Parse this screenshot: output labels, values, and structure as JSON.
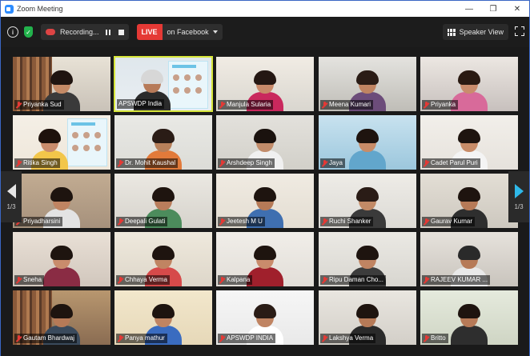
{
  "window": {
    "title": "Zoom Meeting"
  },
  "toolbar": {
    "recording_label": "Recording...",
    "live_label": "LIVE",
    "live_target": "on Facebook",
    "speaker_view_label": "Speaker View"
  },
  "pager": {
    "left": "1/3",
    "right": "1/3"
  },
  "participants": [
    {
      "name": "Priyanka Sud"
    },
    {
      "name": "APSWDP India"
    },
    {
      "name": "Manjula Sularia"
    },
    {
      "name": "Meena Kumari"
    },
    {
      "name": "Priyanka"
    },
    {
      "name": "Ritika Singh"
    },
    {
      "name": "Dr. Mohit Kaushal"
    },
    {
      "name": "Arshdeep Singh"
    },
    {
      "name": "Jaya"
    },
    {
      "name": "Cadet Parul Puri"
    },
    {
      "name": "Priyadharsini"
    },
    {
      "name": "Deepali Gulati"
    },
    {
      "name": "Jeetesh M U"
    },
    {
      "name": "Ruchi Shanker"
    },
    {
      "name": "Gaurav Kumar"
    },
    {
      "name": "Sneha"
    },
    {
      "name": "Chhaya Verma"
    },
    {
      "name": "Kalpana"
    },
    {
      "name": "Ripu Daman Cho..."
    },
    {
      "name": "RAJEEV KUMAR ..."
    },
    {
      "name": "Gautam Bhardwaj"
    },
    {
      "name": "Panya mathur"
    },
    {
      "name": "APSWDP INDIA"
    },
    {
      "name": "Lakshya Verma"
    },
    {
      "name": "Britto"
    }
  ],
  "colors": {
    "accent": "#2d8cff",
    "live": "#e53935",
    "active_speaker": "#d7e63a",
    "muted": "#e53935",
    "next_arrow": "#2fb8e8"
  }
}
